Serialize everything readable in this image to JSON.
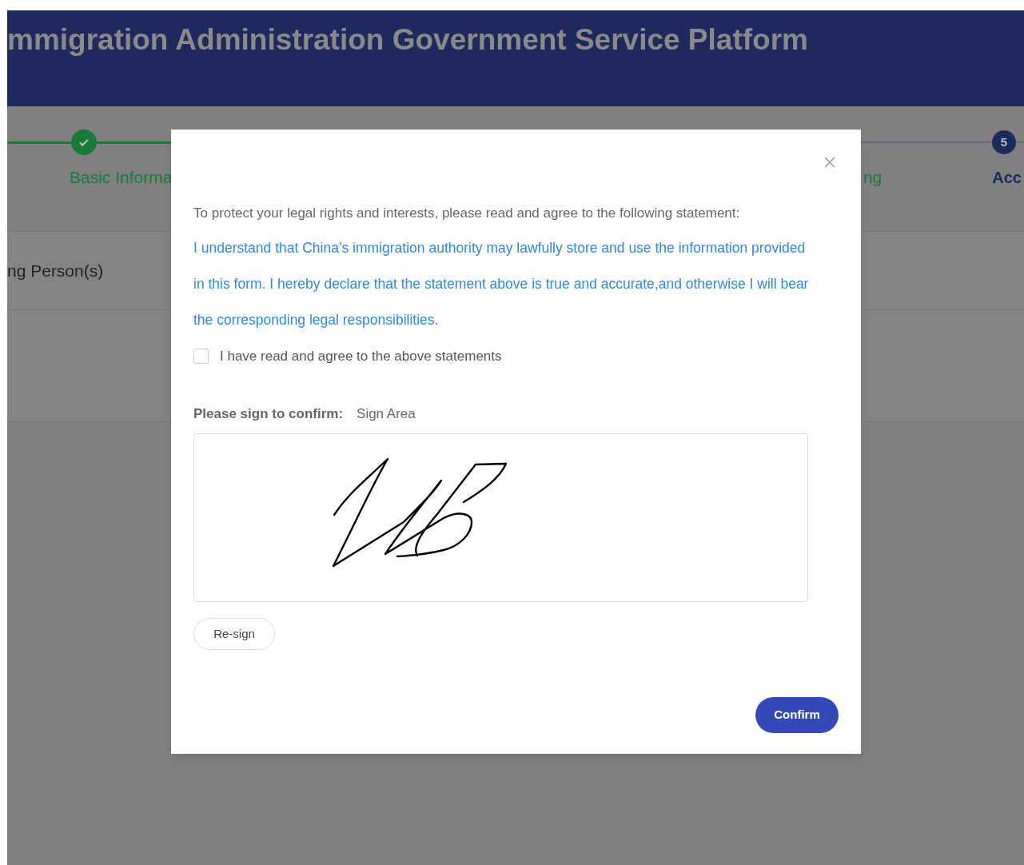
{
  "header": {
    "title": "mmigration Administration Government Service Platform"
  },
  "steps": [
    {
      "label": "Basic Informa",
      "done": true
    },
    {
      "label": "ng",
      "done": true
    },
    {
      "number": "5",
      "label": "Acc",
      "done": false
    }
  ],
  "section": {
    "title": "ng Person(s)"
  },
  "dialog": {
    "intro": "To protect your legal rights and interests, please read and agree to the following statement:",
    "declaration": "I understand that China’s immigration authority may lawfully store and use the information provided in this form. I hereby declare that the statement above is true and accurate,and otherwise I will bear the corresponding legal responsibilities.",
    "agree": {
      "label": "I have read and agree to the above statements",
      "checked": false
    },
    "sign_label": "Please sign to confirm:",
    "sign_hint": "Sign Area",
    "resign_button": "Re-sign",
    "confirm_button": "Confirm"
  }
}
